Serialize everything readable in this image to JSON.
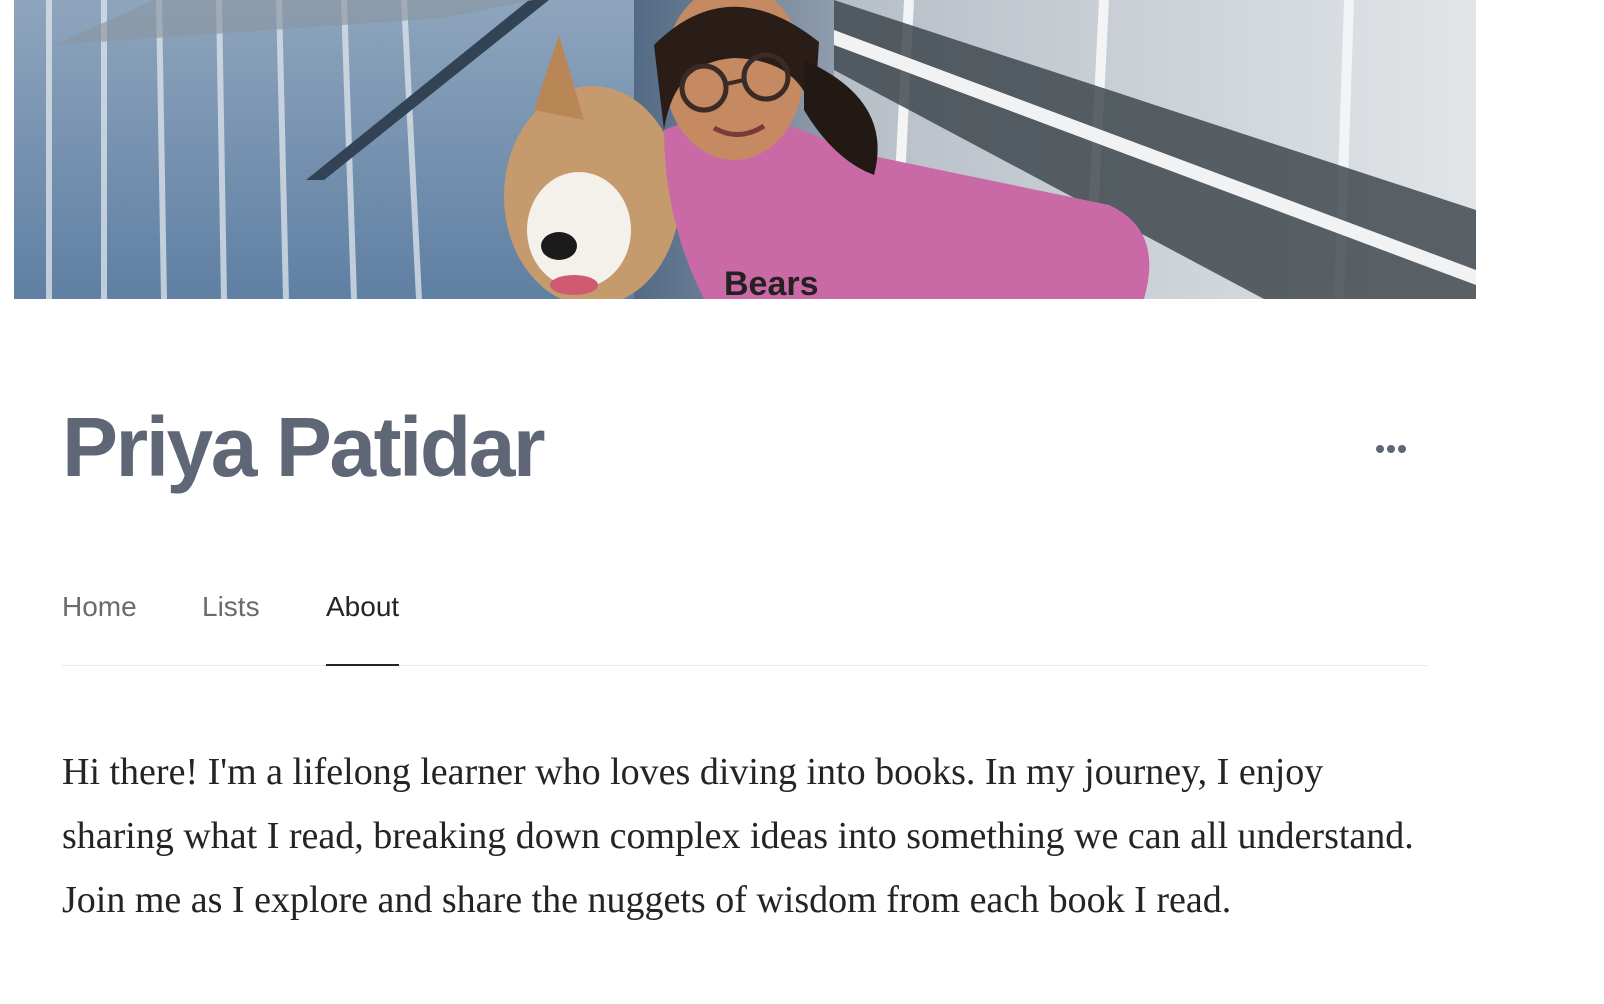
{
  "profile": {
    "cover_image": "profile-cover-photo",
    "name": "Priya Patidar",
    "more_icon": "ellipsis-icon"
  },
  "tabs": [
    {
      "label": "Home",
      "active": false
    },
    {
      "label": "Lists",
      "active": false
    },
    {
      "label": "About",
      "active": true
    }
  ],
  "about": {
    "bio": "Hi there! I'm a lifelong learner who loves diving into books. In my journey, I enjoy sharing what I read, breaking down complex ideas into something we can all understand. Join me as I explore and share the nuggets of wisdom from each book I read."
  },
  "colors": {
    "name": "#5f6776",
    "active_tab": "#242424",
    "inactive_tab": "#6b6b6b",
    "divider": "#e8e8e8"
  }
}
